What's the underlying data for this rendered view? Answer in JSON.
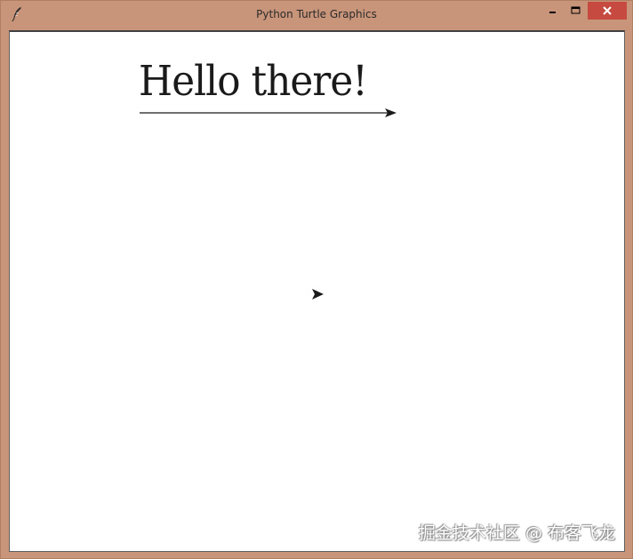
{
  "window": {
    "title": "Python Turtle Graphics",
    "icon": "feather-pen-icon",
    "controls": {
      "minimize_icon": "minimize-icon",
      "maximize_icon": "maximize-icon",
      "close_icon": "close-icon"
    },
    "frame_color": "#c9957a",
    "close_color": "#c74a40"
  },
  "canvas": {
    "text": "Hello there!",
    "turtle_icon": "arrow-turtle-icon"
  },
  "watermark": {
    "text": "掘金技术社区 @ 布客飞龙"
  }
}
